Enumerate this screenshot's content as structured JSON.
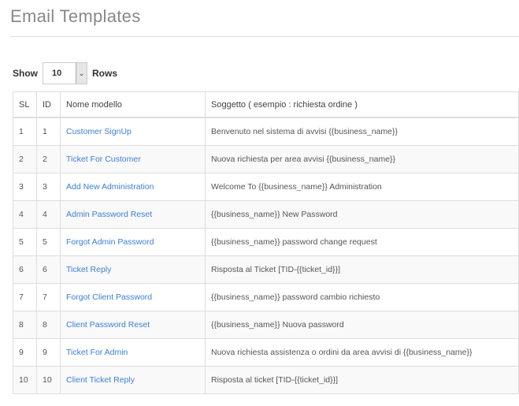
{
  "page": {
    "title": "Email Templates"
  },
  "show": {
    "label": "Show",
    "value": "10",
    "suffix": "Rows"
  },
  "table": {
    "headers": [
      "SL",
      "ID",
      "Nome modello",
      "Soggetto ( esempio : richiesta ordine )"
    ],
    "rows": [
      {
        "sl": "1",
        "id": "1",
        "name": "Customer SignUp",
        "subject": "Benvenuto nel sistema di avvisi {{business_name}}"
      },
      {
        "sl": "2",
        "id": "2",
        "name": "Ticket For Customer",
        "subject": "Nuova richiesta per area avvisi {{business_name}}"
      },
      {
        "sl": "3",
        "id": "3",
        "name": "Add New Administration",
        "subject": "Welcome To {{business_name}} Administration"
      },
      {
        "sl": "4",
        "id": "4",
        "name": "Admin Password Reset",
        "subject": "{{business_name}} New Password"
      },
      {
        "sl": "5",
        "id": "5",
        "name": "Forgot Admin Password",
        "subject": "{{business_name}} password change request"
      },
      {
        "sl": "6",
        "id": "6",
        "name": "Ticket Reply",
        "subject": "Risposta al Ticket [TID-{{ticket_id}}]"
      },
      {
        "sl": "7",
        "id": "7",
        "name": "Forgot Client Password",
        "subject": "{{business_name}} password cambio richiesto"
      },
      {
        "sl": "8",
        "id": "8",
        "name": "Client Password Reset",
        "subject": "{{business_name}} Nuova password"
      },
      {
        "sl": "9",
        "id": "9",
        "name": "Ticket For Admin",
        "subject": "Nuova richiesta assistenza o ordini da area avvisi di {{business_name}}"
      },
      {
        "sl": "10",
        "id": "10",
        "name": "Client Ticket Reply",
        "subject": "Risposta al ticket [TID-{{ticket_id}}]"
      }
    ]
  },
  "colors": {
    "link": "#3a7fd6",
    "stripe": "#f9f9f9"
  },
  "icons": {
    "select": "chevron-down-icon"
  }
}
